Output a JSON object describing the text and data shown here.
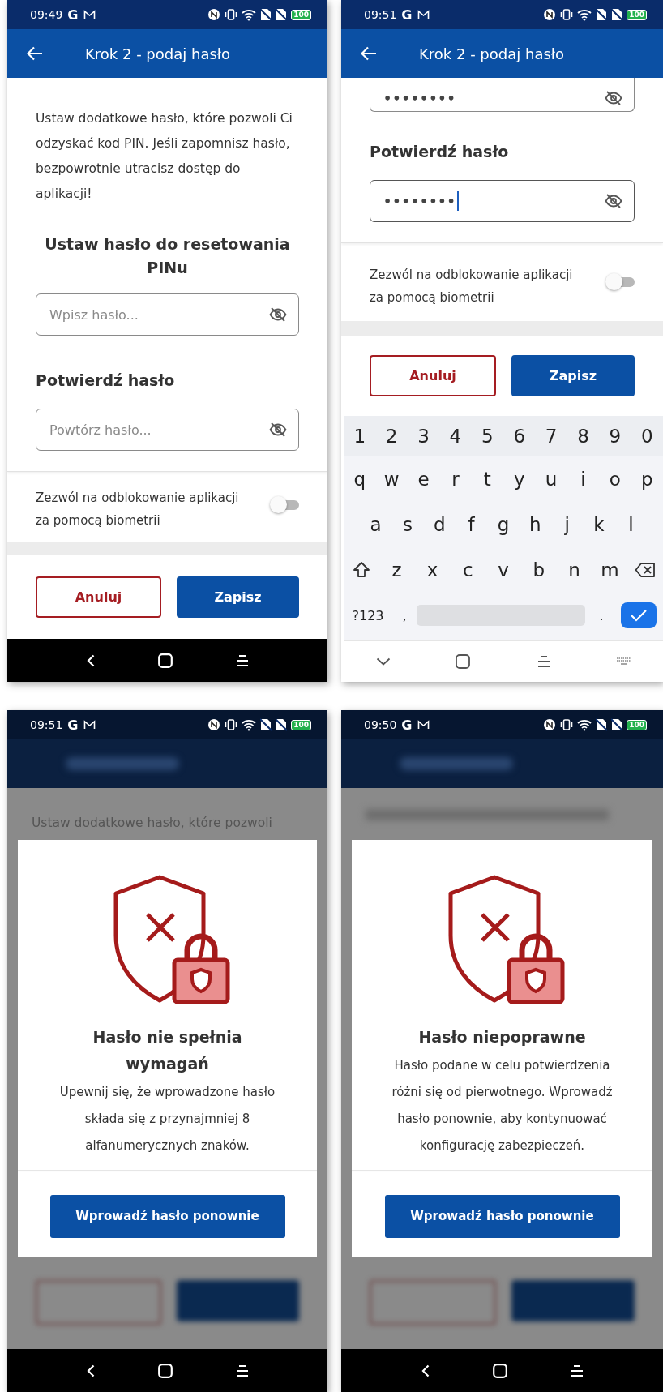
{
  "screens": [
    {
      "kind": "form",
      "status_bar": {
        "time": "09:49",
        "app_icon": "G",
        "battery": "100"
      },
      "app_bar": {
        "title": "Krok 2 - podaj hasło"
      },
      "intro": "Ustaw dodatkowe hasło, które pozwoli Ci odzyskać kod PIN. Jeśli zapomnisz hasło, bezpowrotnie utracisz dostęp do aplikacji!",
      "section_title": "Ustaw hasło do resetowania PINu",
      "password_field": {
        "placeholder": "Wpisz hasło...",
        "focused": false
      },
      "confirm_label": "Potwierdź hasło",
      "confirm_field": {
        "placeholder": "Powtórz hasło...",
        "focused": false
      },
      "biometric": {
        "label": "Zezwól na odblokowanie aplikacji za pomocą biometrii",
        "on": false
      },
      "buttons": [
        {
          "label": "Anuluj",
          "kind": "secondary"
        },
        {
          "label": "Zapisz",
          "kind": "primary"
        }
      ]
    },
    {
      "kind": "form",
      "status_bar": {
        "time": "09:51",
        "app_icon": "G",
        "battery": "100"
      },
      "app_bar": {
        "title": "Krok 2 - podaj hasło"
      },
      "password_field": {
        "value": "••••••••",
        "focused": false
      },
      "confirm_label": "Potwierdź hasło",
      "confirm_field": {
        "value": "••••••••",
        "focused": true
      },
      "biometric": {
        "label": "Zezwól na odblokowanie aplikacji za pomocą biometrii",
        "on": false
      },
      "buttons": [
        {
          "label": "Anuluj",
          "kind": "secondary"
        },
        {
          "label": "Zapisz",
          "kind": "primary"
        }
      ],
      "keyboard": {
        "digit_keys": [
          "1",
          "2",
          "3",
          "4",
          "5",
          "6",
          "7",
          "8",
          "9",
          "0"
        ],
        "top_letter_keys": [
          "q",
          "w",
          "e",
          "r",
          "t",
          "y",
          "u",
          "i",
          "o",
          "p"
        ],
        "middle_letter_keys": [
          "a",
          "s",
          "d",
          "f",
          "g",
          "h",
          "j",
          "k",
          "l"
        ],
        "bottom_letter_keys": [
          "z",
          "x",
          "c",
          "v",
          "b",
          "n",
          "m"
        ],
        "symbols_key": "?123",
        "comma_key": ",",
        "period_key": "."
      }
    },
    {
      "kind": "dialog",
      "status_bar": {
        "time": "09:51",
        "app_icon": "G",
        "battery": "100"
      },
      "background_text": "Ustaw dodatkowe hasło, które pozwoli",
      "dialog": {
        "title": "Hasło nie spełnia wymagań",
        "message": "Upewnij się, że wprowadzone hasło składa się z przynajmniej 8 alfanumerycznych znaków.",
        "button": "Wprowadź hasło ponownie"
      }
    },
    {
      "kind": "dialog",
      "status_bar": {
        "time": "09:50",
        "app_icon": "G",
        "battery": "100"
      },
      "dialog": {
        "title": "Hasło niepoprawne",
        "message": "Hasło podane w celu potwierdzenia różni się od pierwotnego. Wprowadź hasło ponownie, aby kontynuować konfigurację zabezpieczeń.",
        "button": "Wprowadź hasło ponownie"
      }
    }
  ]
}
